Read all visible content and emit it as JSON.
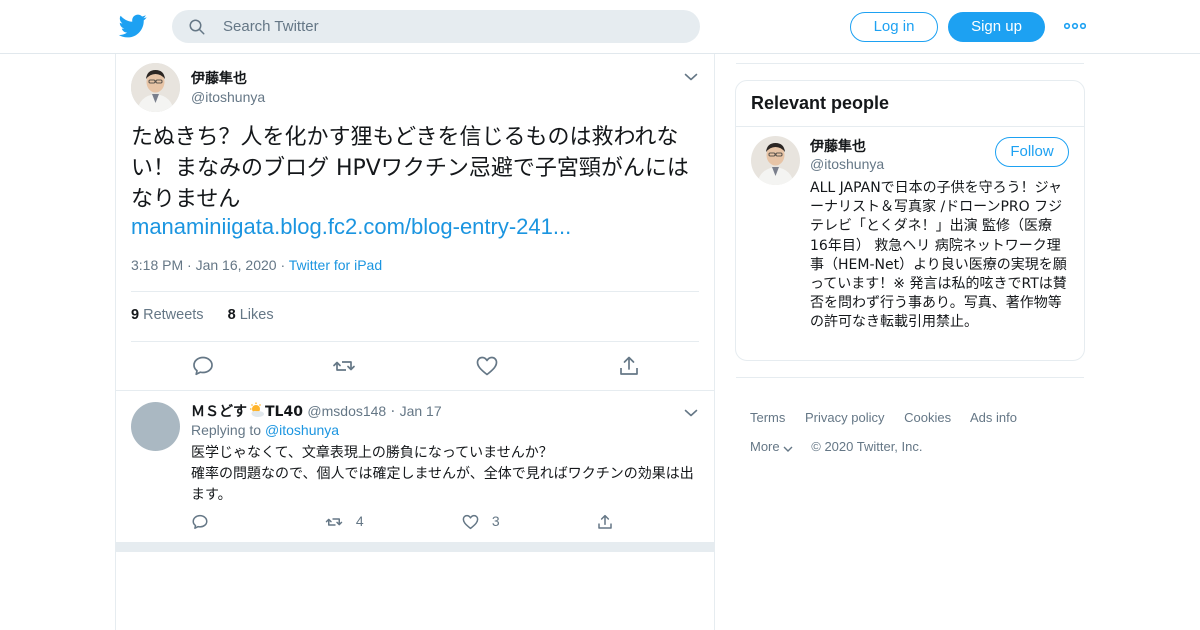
{
  "header": {
    "search_placeholder": "Search Twitter",
    "login_label": "Log in",
    "signup_label": "Sign up"
  },
  "tweet": {
    "author_name": "伊藤隼也",
    "author_handle": "@itoshunya",
    "text": "たぬきち？人を化かす狸もどきを信じるものは救われない！まなみのブログ HPVワクチン忌避で子宮頸がんにはなりません",
    "link": "manaminiigata.blog.fc2.com/blog-entry-241...",
    "time": "3:18 PM",
    "date": "Jan 16, 2020",
    "source": "Twitter for iPad",
    "retweets_count": "9",
    "retweets_label": "Retweets",
    "likes_count": "8",
    "likes_label": "Likes"
  },
  "reply": {
    "author_name": "ＭＳどす",
    "author_name_suffix": "TL40",
    "author_handle": "@msdos148",
    "date": "Jan 17",
    "replying_to_label": "Replying to",
    "replying_to_handle": "@itoshunya",
    "text_line1": "医学じゃなくて、文章表現上の勝負になっていませんか？",
    "text_line2": "確率の問題なので、個人では確定しませんが、全体で見ればワクチンの効果は出ます。",
    "retweets": "4",
    "likes": "3"
  },
  "sidebar": {
    "relevant_title": "Relevant people",
    "person_name": "伊藤隼也",
    "person_handle": "@itoshunya",
    "follow_label": "Follow",
    "bio": "ALL JAPANで日本の子供を守ろう！ジャーナリスト＆写真家 /ドローンPRO フジテレビ「とくダネ！」出演 監修（医療 16年目） 救急ヘリ 病院ネットワーク理事（HEM-Net）より良い医療の実現を願っています！※ 発言は私的呟きでRTは賛否を問わず行う事あり。写真、著作物等の許可なき転載引用禁止。"
  },
  "footer": {
    "terms": "Terms",
    "privacy": "Privacy policy",
    "cookies": "Cookies",
    "ads": "Ads info",
    "more": "More",
    "copyright": "© 2020 Twitter, Inc."
  },
  "colors": {
    "brand_blue": "#1da1f2",
    "link_blue": "#1b95e0",
    "muted": "#657786"
  }
}
